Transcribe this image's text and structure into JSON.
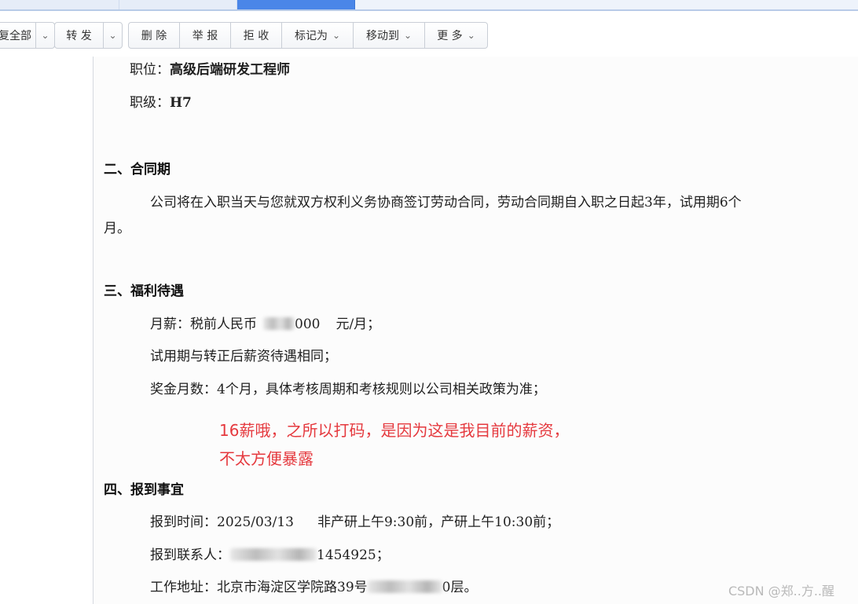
{
  "toolbar": {
    "reply_all": "复全部",
    "forward": "转 发",
    "delete": "删 除",
    "report": "举 报",
    "reject": "拒 收",
    "mark_as": "标记为",
    "move_to": "移动到",
    "more": "更 多",
    "dropdown_icon": "chevron-down-icon"
  },
  "letter": {
    "position_label": "职位：",
    "position_value": "高级后端研发工程师",
    "level_label": "职级：",
    "level_value": "H7",
    "section2_title": "二、合同期",
    "section2_body_line1": "公司将在入职当天与您就双方权利义务协商签订劳动合同，劳动合同期自入职之日起3年，试用期6个",
    "section2_body_line2": "月。",
    "section3_title": "三、福利待遇",
    "salary_prefix": "月薪：税前人民币",
    "salary_visible": "000",
    "salary_suffix": "元/月；",
    "probation_line": "试用期与转正后薪资待遇相同；",
    "bonus_line": "奖金月数：4个月，具体考核周期和考核规则以公司相关政策为准；",
    "section4_title": "四、报到事宜",
    "report_time_label": "报到时间：",
    "report_time_date": "2025/03/13",
    "report_time_detail": "非产研上午9:30前，产研上午10:30前；",
    "contact_label": "报到联系人：",
    "contact_visible": "1454925；",
    "address_label": "工作地址：北京市海淀区学院路39号",
    "address_visible": "0层。"
  },
  "annotation": {
    "text": "16薪哦，之所以打码，是因为这是我目前的薪资，不太方便暴露",
    "color": "#e5393e"
  },
  "watermark": "CSDN @郑..方..醒"
}
